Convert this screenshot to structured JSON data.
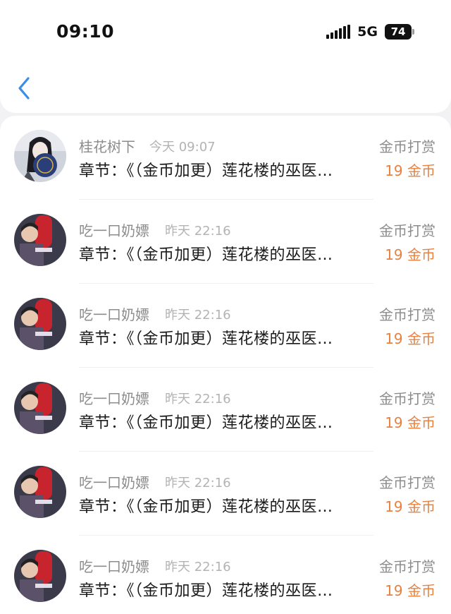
{
  "status": {
    "time": "09:10",
    "network": "5G",
    "battery": "74"
  },
  "nav": {
    "back_icon": "chevron-left-icon",
    "accent_color": "#3a8ee6"
  },
  "colors": {
    "amount": "#e8813f",
    "secondary": "#8c8c8c"
  },
  "items": [
    {
      "name": "桂花树下",
      "time": "今天 09:07",
      "title": "章节：《（金币加更）莲花楼的巫医…",
      "label": "金币打赏",
      "amount": "19 金币",
      "avatar": "avatar-woman"
    },
    {
      "name": "吃一口奶嫖",
      "time": "昨天 22:16",
      "title": "章节：《（金币加更）莲花楼的巫医…",
      "label": "金币打赏",
      "amount": "19 金币",
      "avatar": "avatar-man"
    },
    {
      "name": "吃一口奶嫖",
      "time": "昨天 22:16",
      "title": "章节：《（金币加更）莲花楼的巫医…",
      "label": "金币打赏",
      "amount": "19 金币",
      "avatar": "avatar-man"
    },
    {
      "name": "吃一口奶嫖",
      "time": "昨天 22:16",
      "title": "章节：《（金币加更）莲花楼的巫医…",
      "label": "金币打赏",
      "amount": "19 金币",
      "avatar": "avatar-man"
    },
    {
      "name": "吃一口奶嫖",
      "time": "昨天 22:16",
      "title": "章节：《（金币加更）莲花楼的巫医…",
      "label": "金币打赏",
      "amount": "19 金币",
      "avatar": "avatar-man"
    },
    {
      "name": "吃一口奶嫖",
      "time": "昨天 22:16",
      "title": "章节：《（金币加更）莲花楼的巫医…",
      "label": "金币打赏",
      "amount": "19 金币",
      "avatar": "avatar-man"
    }
  ]
}
